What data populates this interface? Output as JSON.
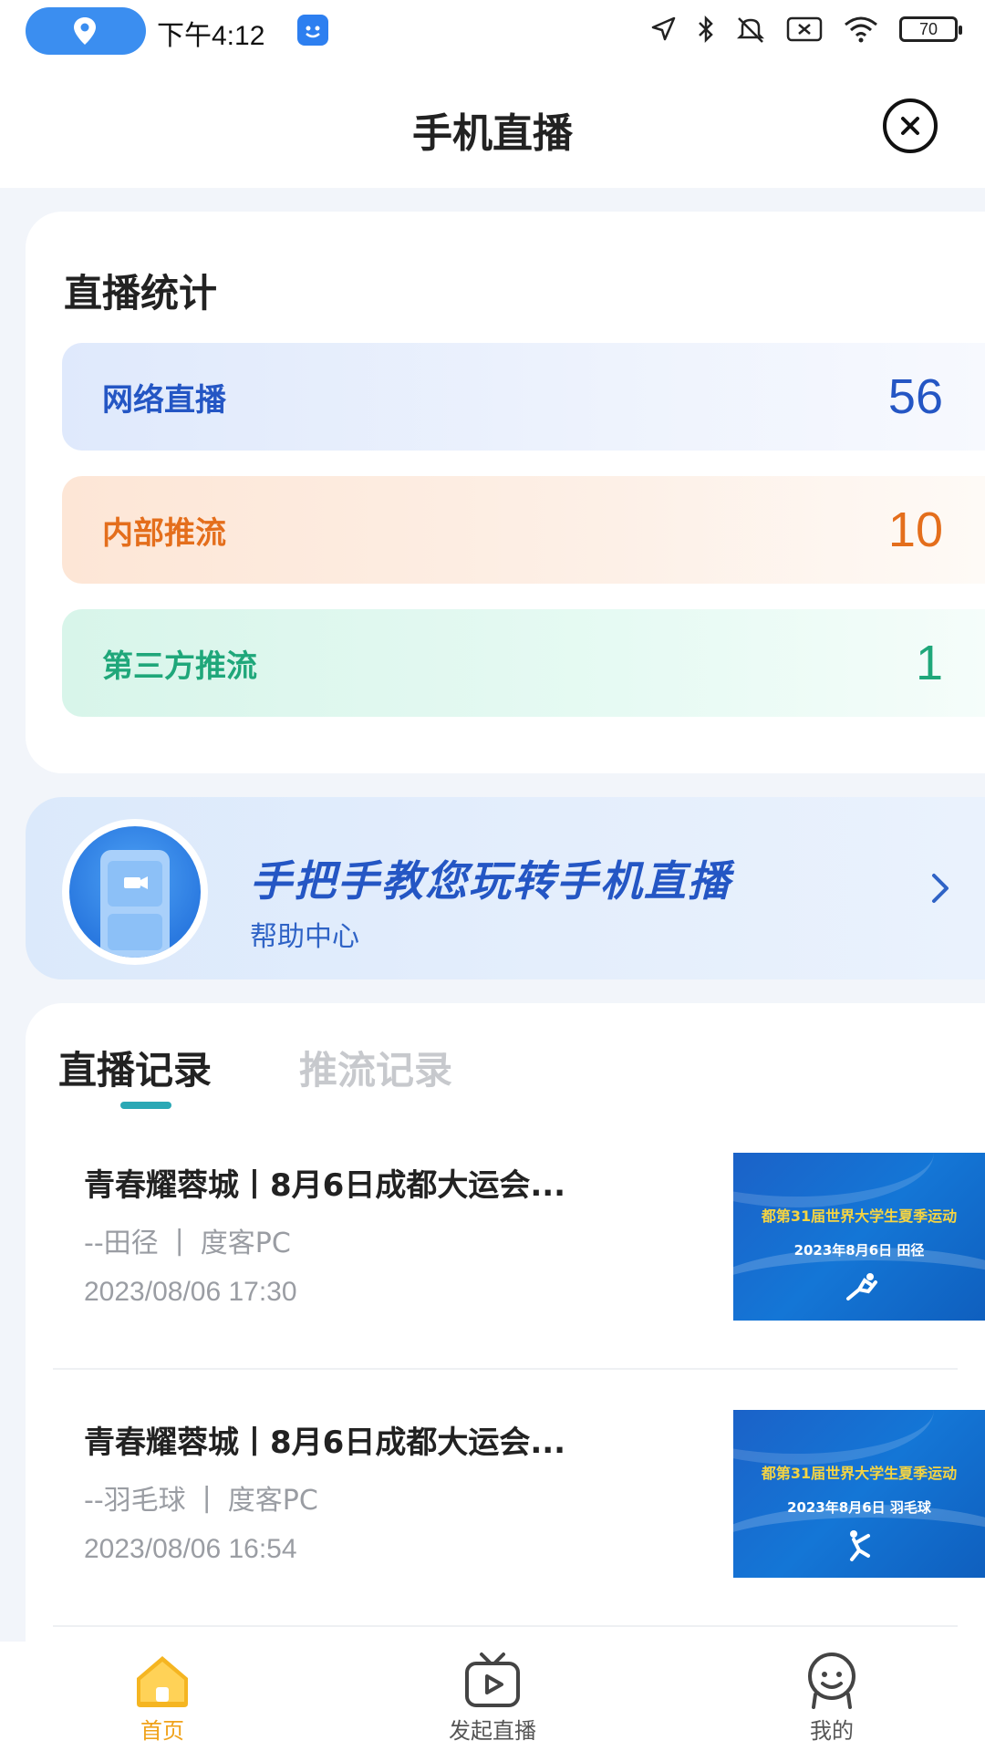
{
  "status_bar": {
    "time": "下午4:12",
    "battery": "70",
    "icons": [
      "location-icon",
      "app-badge-icon",
      "navigation-icon",
      "bluetooth-icon",
      "mute-icon",
      "sim-icon",
      "wifi-icon",
      "battery-icon"
    ]
  },
  "header": {
    "title": "手机直播",
    "close_icon": "close-icon"
  },
  "stats": {
    "title": "直播统计",
    "rows": [
      {
        "label": "网络直播",
        "value": "56",
        "color": "#2456c4"
      },
      {
        "label": "内部推流",
        "value": "10",
        "color": "#e46e1c"
      },
      {
        "label": "第三方推流",
        "value": "1",
        "color": "#1fa77a"
      }
    ]
  },
  "help": {
    "title": "手把手教您玩转手机直播",
    "subtitle": "帮助中心"
  },
  "records": {
    "tabs": [
      {
        "label": "直播记录",
        "active": true
      },
      {
        "label": "推流记录",
        "active": false
      }
    ],
    "items": [
      {
        "title": "青春耀蓉城丨8月6日成都大运会...",
        "sport": "--田径",
        "sep": "|",
        "source": "度客PC",
        "date": "2023/08/06 17:30",
        "thumb_banner": "都第31届世界大学生夏季运动",
        "thumb_sub": "2023年8月6日  田径"
      },
      {
        "title": "青春耀蓉城丨8月6日成都大运会...",
        "sport": "--羽毛球",
        "sep": "|",
        "source": "度客PC",
        "date": "2023/08/06 16:54",
        "thumb_banner": "都第31届世界大学生夏季运动",
        "thumb_sub": "2023年8月6日  羽毛球"
      }
    ]
  },
  "bottom_nav": {
    "items": [
      {
        "label": "首页",
        "icon": "home-icon",
        "active": true,
        "color": "#f0a21a"
      },
      {
        "label": "发起直播",
        "icon": "tv-play-icon",
        "active": false
      },
      {
        "label": "我的",
        "icon": "profile-icon",
        "active": false
      }
    ]
  },
  "colors": {
    "accent_blue": "#2456c4",
    "accent_orange": "#e46e1c",
    "accent_green": "#1fa77a",
    "tab_indicator": "#2aa8b5",
    "nav_active": "#f0a21a"
  }
}
